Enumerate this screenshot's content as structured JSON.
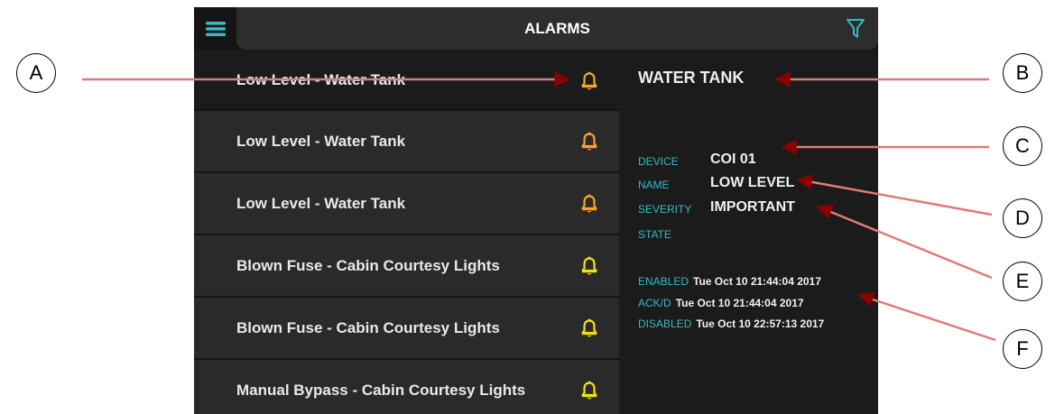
{
  "header": {
    "title": "ALARMS",
    "menu_icon": "hamburger-menu-icon",
    "filter_icon": "filter-icon"
  },
  "alarms": [
    {
      "label": "Low Level - Water Tank",
      "bell_color": "#f5a623",
      "selected": true
    },
    {
      "label": "Low Level - Water Tank",
      "bell_color": "#f5a623",
      "selected": false
    },
    {
      "label": "Low Level - Water Tank",
      "bell_color": "#f5a623",
      "selected": false
    },
    {
      "label": "Blown Fuse - Cabin Courtesy Lights",
      "bell_color": "#f2e10f",
      "selected": false
    },
    {
      "label": "Blown Fuse - Cabin Courtesy Lights",
      "bell_color": "#f2e10f",
      "selected": false
    },
    {
      "label": "Manual Bypass - Cabin Courtesy Lights",
      "bell_color": "#f2e10f",
      "selected": false
    }
  ],
  "detail": {
    "title": "WATER TANK",
    "fields": {
      "device_label": "DEVICE",
      "device_value": "COI 01",
      "name_label": "NAME",
      "name_value": "LOW LEVEL",
      "severity_label": "SEVERITY",
      "severity_value": "IMPORTANT",
      "state_label": "STATE"
    },
    "times": {
      "enabled_label": "ENABLED",
      "enabled_value": "Tue Oct 10 21:44:04 2017",
      "ackd_label": "ACK/D",
      "ackd_value": "Tue Oct 10 21:44:04 2017",
      "disabled_label": "DISABLED",
      "disabled_value": "Tue Oct 10 22:57:13 2017"
    }
  },
  "callouts": {
    "a": "A",
    "b": "B",
    "c": "C",
    "d": "D",
    "e": "E",
    "f": "F"
  },
  "colors": {
    "accent": "#3ab7c4",
    "bell_important": "#f5a623",
    "bell_warning": "#f2e10f",
    "callout_line": "#e07a7a",
    "arrow_head": "#8b0000"
  }
}
